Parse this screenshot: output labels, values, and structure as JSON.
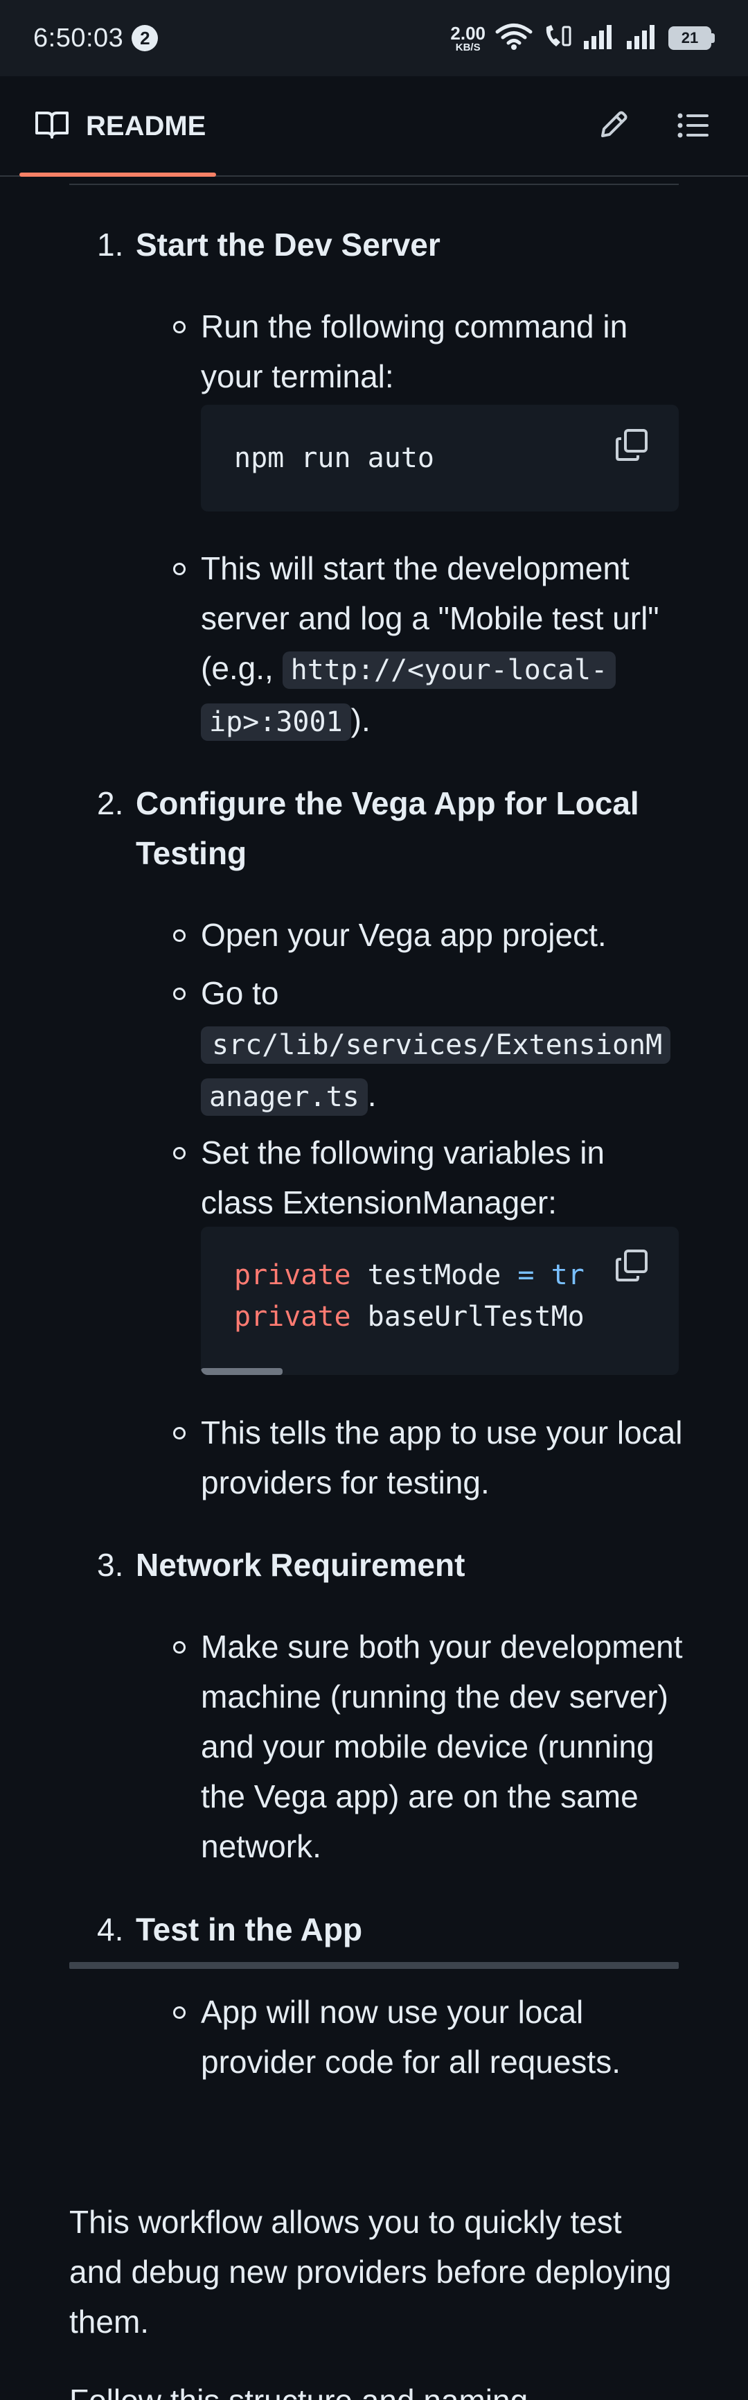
{
  "status_bar": {
    "time": "6:50:03",
    "notification_count": "2",
    "net_speed_value": "2.00",
    "net_speed_unit": "KB/S",
    "battery": "21"
  },
  "header": {
    "tab_label": "README",
    "icons": {
      "tab": "book-icon",
      "edit": "pencil-icon",
      "toc": "list-icon"
    }
  },
  "content": {
    "steps": [
      {
        "number": "1.",
        "title": "Start the Dev Server",
        "bullets": [
          "Run the following command in your terminal:",
          "This will start the development server and log a \"Mobile test url\" (e.g., ",
          ")."
        ],
        "inline_code_1": "http://<your-local-",
        "inline_code_2": "ip>:3001",
        "code": "npm run auto"
      },
      {
        "number": "2.",
        "title": "Configure the Vega App for Local Testing",
        "bullet_open": "Open your Vega app project.",
        "bullet_goto": "Go to",
        "path_code_1": "src/lib/services/ExtensionM",
        "path_code_2": "anager.ts",
        "path_suffix": ".",
        "bullet_set": "Set the following variables in class ExtensionManager:",
        "code_line1_kw": "private",
        "code_line1_var": " testMode ",
        "code_line1_op": "= tr",
        "code_line2_kw": "private",
        "code_line2_var": " baseUrlTestMo",
        "bullet_tells": "This tells the app to use your local providers for testing."
      },
      {
        "number": "3.",
        "title": "Network Requirement",
        "bullet": "Make sure both your development machine (running the dev server) and your mobile device (running the Vega app) are on the same network."
      },
      {
        "number": "4.",
        "title": "Test in the App",
        "bullet": "App will now use your local provider code for all requests."
      }
    ],
    "closing_paragraph": "This workflow allows you to quickly test and debug new providers before deploying them.",
    "partial_paragraph": "Follow this structure and naming"
  },
  "colors": {
    "background": "#0d1117",
    "accent_underline": "#f78166",
    "keyword": "#ff7b72",
    "operator": "#79c0ff"
  }
}
